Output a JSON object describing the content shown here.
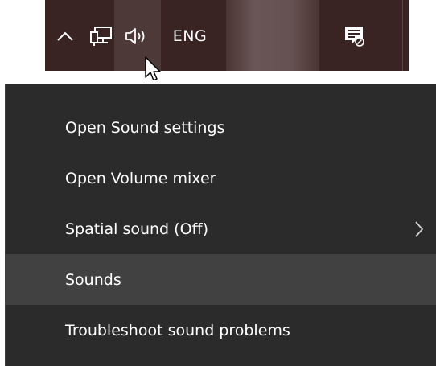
{
  "taskbar": {
    "language": "ENG",
    "icons": [
      "chevron-up-icon",
      "network-icon",
      "volume-icon",
      "notification-icon"
    ]
  },
  "menu": {
    "items": [
      {
        "label": "Open Sound settings",
        "has_submenu": false,
        "highlighted": false
      },
      {
        "label": "Open Volume mixer",
        "has_submenu": false,
        "highlighted": false
      },
      {
        "label": "Spatial sound (Off)",
        "has_submenu": true,
        "highlighted": false
      },
      {
        "label": "Sounds",
        "has_submenu": false,
        "highlighted": true
      },
      {
        "label": "Troubleshoot sound problems",
        "has_submenu": false,
        "highlighted": false
      }
    ]
  },
  "colors": {
    "taskbar_bg": "#3a2323",
    "menu_bg": "#2b2b2b",
    "menu_hover": "#414141",
    "text": "#ffffff"
  }
}
